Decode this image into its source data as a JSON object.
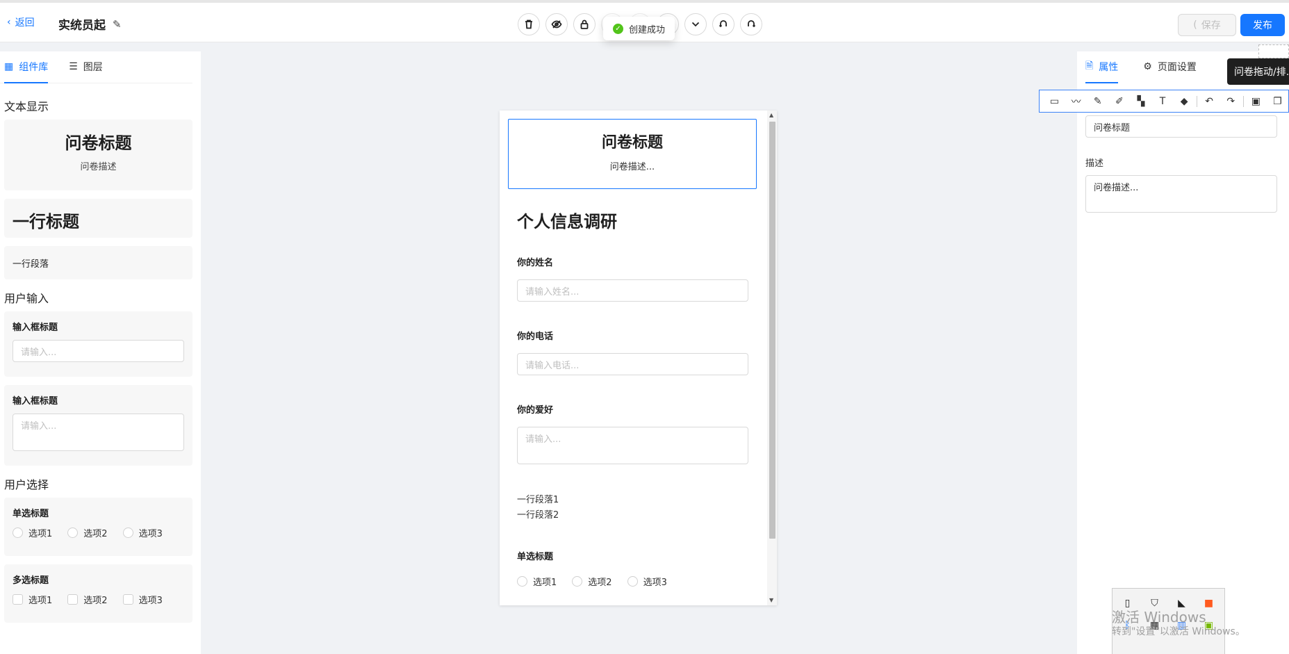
{
  "header": {
    "back_label": "返回",
    "title": "实统员起",
    "save_label": "保存",
    "publish_label": "发布",
    "toast": "创建成功"
  },
  "toolbar_icons": [
    "delete-icon",
    "hide-icon",
    "lock-icon",
    "copy-icon",
    "paste-icon",
    "move-up-icon",
    "move-down-icon",
    "undo-icon",
    "redo-icon"
  ],
  "left": {
    "tabs": [
      {
        "label": "组件库"
      },
      {
        "label": "图层"
      }
    ],
    "sections": {
      "text_display": "文本显示",
      "user_input": "用户输入",
      "user_choice": "用户选择"
    },
    "comp_title": "问卷标题",
    "comp_desc": "问卷描述",
    "comp_heading": "一行标题",
    "comp_paragraph": "一行段落",
    "input_title_1": "输入框标题",
    "input_placeholder_1": "请输入...",
    "input_title_2": "输入框标题",
    "input_placeholder_2": "请输入...",
    "radio_title": "单选标题",
    "radio_options": [
      "选项1",
      "选项2",
      "选项3"
    ],
    "checkbox_title": "多选标题",
    "checkbox_options": [
      "选项1",
      "选项2",
      "选项3"
    ]
  },
  "canvas": {
    "title": "问卷标题",
    "desc": "问卷描述...",
    "heading": "个人信息调研",
    "name_label": "你的姓名",
    "name_placeholder": "请输入姓名...",
    "phone_label": "你的电话",
    "phone_placeholder": "请输入电话...",
    "hobby_label": "你的爱好",
    "hobby_placeholder": "请输入...",
    "para_line1": "一行段落1",
    "para_line2": "一行段落2",
    "radio_title": "单选标题",
    "radio_options": [
      "选项1",
      "选项2",
      "选项3"
    ]
  },
  "right": {
    "tabs": [
      {
        "label": "属性"
      },
      {
        "label": "页面设置"
      }
    ],
    "title_value": "问卷标题",
    "desc_label": "描述",
    "desc_value": "问卷描述...",
    "tooltip": "问卷拖动/排..."
  },
  "overlay": {
    "watermark_line1": "激活 Windows",
    "watermark_line2": "转到\"设置\"以激活 Windows。"
  }
}
